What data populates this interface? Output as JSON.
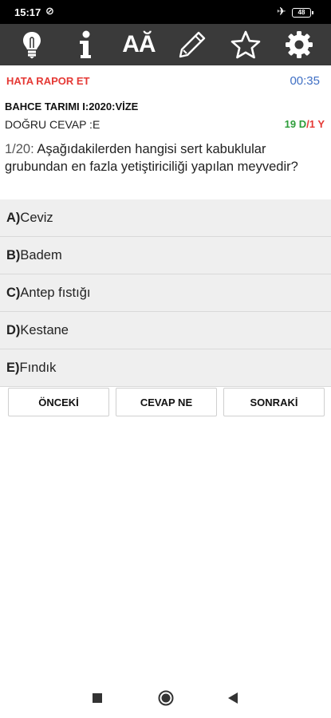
{
  "status": {
    "time": "15:17",
    "battery": "48"
  },
  "icons": {
    "toolbar": [
      "lightbulb-icon",
      "info-icon",
      "font-size-icon",
      "pencil-icon",
      "star-icon",
      "gear-icon"
    ],
    "system_nav": [
      "square-icon",
      "circle-icon",
      "back-triangle-icon"
    ]
  },
  "toolbar": {
    "font_label": "AĂ"
  },
  "header": {
    "report_label": "HATA RAPOR ET",
    "timer": "00:35",
    "exam_title": "BAHCE TARIMI I:2020:VİZE",
    "correct_answer": "DOĞRU CEVAP :E",
    "score_correct": "19 D",
    "score_sep": "/",
    "score_wrong": "1 Y"
  },
  "question": {
    "number": "1/20:",
    "text": " Aşağıdakilerden hangisi sert kabuklular grubundan en fazla yetiştiriciliği yapılan meyvedir?"
  },
  "options": [
    {
      "letter": "A)",
      "text": " Ceviz"
    },
    {
      "letter": "B)",
      "text": " Badem"
    },
    {
      "letter": "C)",
      "text": " Antep fıstığı"
    },
    {
      "letter": "D)",
      "text": " Kestane"
    },
    {
      "letter": "E)",
      "text": " Fındık"
    }
  ],
  "nav": {
    "prev": "ÖNCEKİ",
    "answer": "CEVAP NE",
    "next": "SONRAKİ"
  },
  "colors": {
    "toolbar_bg": "#3a3a3a",
    "report": "#e53935",
    "timer": "#3f6fc4",
    "correct": "#2e9d3a",
    "wrong": "#e53935",
    "option_bg": "#efefef"
  }
}
